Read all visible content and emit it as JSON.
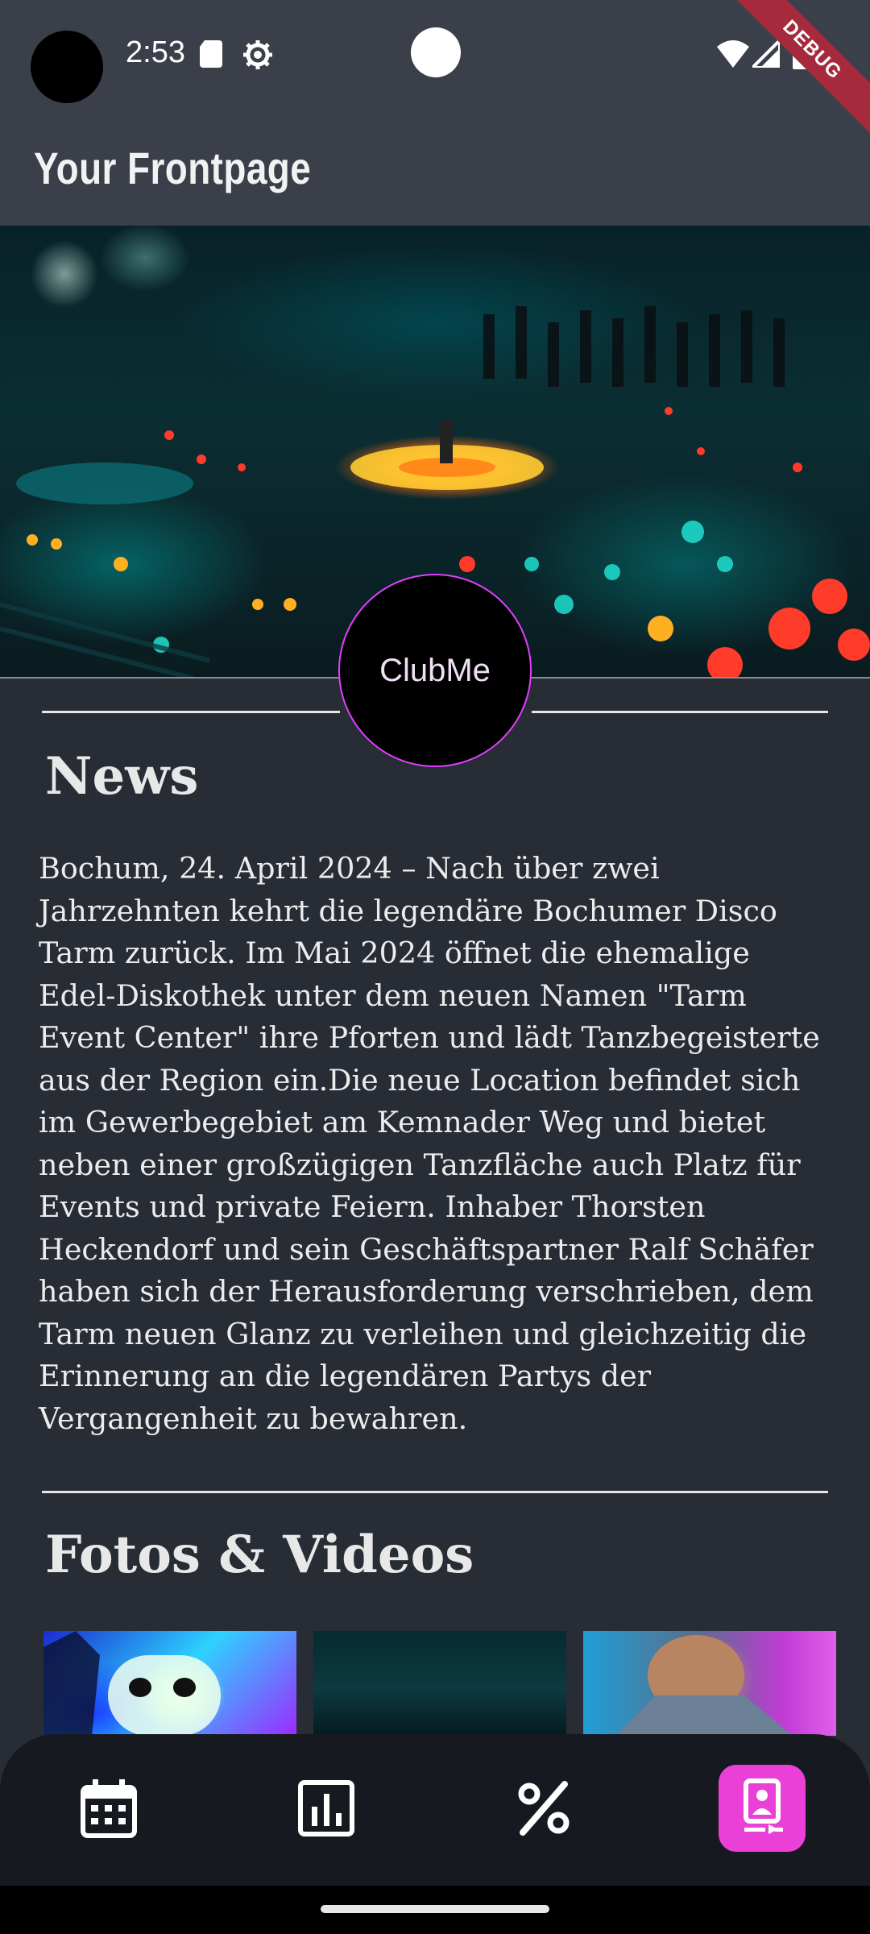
{
  "status_bar": {
    "time": "2:53",
    "icons": [
      "sd-card-icon",
      "gear-icon",
      "wifi-icon",
      "signal-icon",
      "battery-icon"
    ],
    "debug_label": "DEBUG"
  },
  "app_bar": {
    "title": "Your Frontpage"
  },
  "hero": {
    "logo_text": "ClubMe",
    "accent_color": "#e040fb"
  },
  "news": {
    "title": "News",
    "body": "Bochum, 24. April 2024 – Nach über zwei Jahrzehnten kehrt die legendäre Bochumer Disco Tarm zurück. Im Mai 2024 öffnet die ehemalige Edel-Diskothek unter dem neuen Namen \"Tarm Event Center\" ihre Pforten und lädt Tanzbegeisterte aus der Region ein.Die neue Location befindet sich im Gewerbegebiet am Kemnader Weg und bietet neben einer großzügigen Tanzfläche auch Platz für Events und private Feiern. Inhaber Thorsten Heckendorf und sein Geschäftspartner Ralf Schäfer haben sich der Herausforderung verschrieben, dem Tarm neuen Glanz zu verleihen und gleichzeitig die Erinnerung an die legendären Partys der Vergangenheit zu bewahren."
  },
  "media": {
    "title": "Fotos & Videos",
    "thumbnails": [
      "photo-thumbnail",
      "photo-thumbnail",
      "photo-thumbnail"
    ]
  },
  "bottom_nav": {
    "items": [
      {
        "icon": "calendar-icon",
        "active": false
      },
      {
        "icon": "bar-chart-icon",
        "active": false
      },
      {
        "icon": "percent-icon",
        "active": false
      },
      {
        "icon": "club-card-icon",
        "active": true
      }
    ],
    "active_color": "#ea40d8"
  }
}
